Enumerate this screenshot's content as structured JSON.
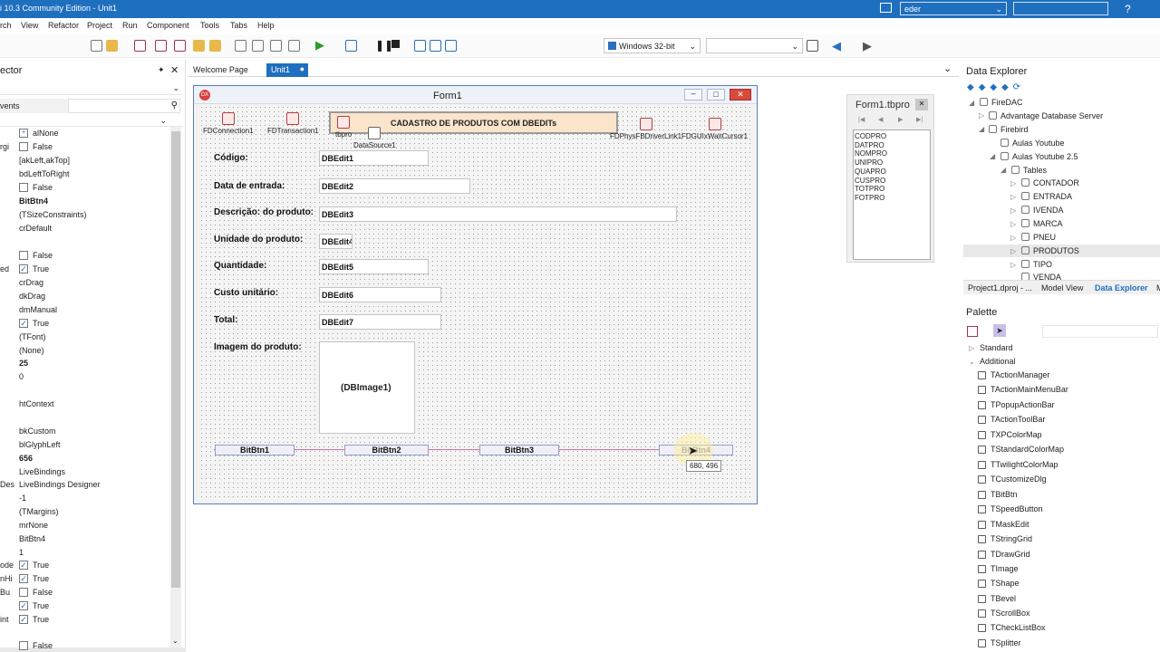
{
  "titlebar": {
    "title": "i 10.3 Community Edition - Unit1",
    "user": "eder",
    "help": "?"
  },
  "menu": [
    "rch",
    "View",
    "Refactor",
    "Project",
    "Run",
    "Component",
    "Tools",
    "Tabs",
    "Help"
  ],
  "toolbar": {
    "platform": "Windows 32-bit",
    "config": ""
  },
  "inspector": {
    "title": "ector",
    "events_label": "vents",
    "left_cut": [
      "rgi",
      "ed",
      "Des",
      "ode",
      "nHi",
      "Bu",
      "int"
    ],
    "values": [
      "alNone",
      "False",
      "[akLeft,akTop]",
      "bdLeftToRight",
      "False",
      "BitBtn4",
      "(TSizeConstraints)",
      "crDefault",
      "False",
      "True",
      "crDrag",
      "dkDrag",
      "dmManual",
      "True",
      "(TFont)",
      "(None)",
      "25",
      "0",
      "htContext",
      "bkCustom",
      "blGlyphLeft",
      "656",
      "LiveBindings",
      "LiveBindings Designer",
      "-1",
      "(TMargins)",
      "mrNone",
      "BitBtn4",
      "1",
      "True",
      "True",
      "False",
      "True",
      "True",
      "False"
    ]
  },
  "tabs": {
    "welcome": "Welcome Page",
    "unit1": "Unit1"
  },
  "form": {
    "caption": "Form1",
    "header": "CADASTRO DE PRODUTOS COM DBEDITs",
    "components": {
      "fdconn": "FDConnection1",
      "fdtrans": "FDTransaction1",
      "tbpro": "tbpro",
      "ds": "DataSource1",
      "fdphys": "FDPhysFBDriverLink1",
      "fdgui": "FDGUIxWaitCursor1"
    },
    "labels": {
      "codigo": "Código:",
      "data": "Data de entrada:",
      "descricao": "Descrição: do produto:",
      "unidade": "Unidade do produto:",
      "quantidade": "Quantidade:",
      "custo": "Custo unitário:",
      "total": "Total:",
      "imagem": "Imagem do produto:"
    },
    "edits": {
      "e1": "DBEdit1",
      "e2": "DBEdit2",
      "e3": "DBEdit3",
      "e4": "DBEdit4",
      "e5": "DBEdit5",
      "e6": "DBEdit6",
      "e7": "DBEdit7"
    },
    "image": "(DBImage1)",
    "buttons": [
      "BitBtn1",
      "BitBtn2",
      "BitBtn3",
      "BitBtn4"
    ],
    "tooltip": "680, 496"
  },
  "fields_editor": {
    "title": "Form1.tbpro",
    "fields": [
      "CODPRO",
      "DATPRO",
      "NOMPRO",
      "UNIPRO",
      "QUAPRO",
      "CUSPRO",
      "TOTPRO",
      "FOTPRO"
    ]
  },
  "data_explorer": {
    "title": "Data Explorer",
    "nodes": {
      "firedac": "FireDAC",
      "ads": "Advantage Database Server",
      "firebird": "Firebird",
      "aulas": "Aulas Youtube",
      "aulas25": "Aulas Youtube 2.5",
      "tables": "Tables"
    },
    "tables": [
      "CONTADOR",
      "ENTRADA",
      "IVENDA",
      "MARCA",
      "PNEU",
      "PRODUTOS",
      "TIPO",
      "VENDA"
    ],
    "tabs": [
      "Project1.dproj - ...",
      "Model View",
      "Data Explorer",
      "M"
    ]
  },
  "palette": {
    "title": "Palette",
    "cats": [
      "Standard",
      "Additional"
    ],
    "items": [
      "TActionManager",
      "TActionMainMenuBar",
      "TPopupActionBar",
      "TActionToolBar",
      "TXPColorMap",
      "TStandardColorMap",
      "TTwilightColorMap",
      "TCustomizeDlg",
      "TBitBtn",
      "TSpeedButton",
      "TMaskEdit",
      "TStringGrid",
      "TDrawGrid",
      "TImage",
      "TShape",
      "TBevel",
      "TScrollBox",
      "TCheckListBox",
      "TSplitter"
    ]
  },
  "colors": {
    "accent": "#1f6fbf",
    "form_border": "#5a7cb8"
  }
}
